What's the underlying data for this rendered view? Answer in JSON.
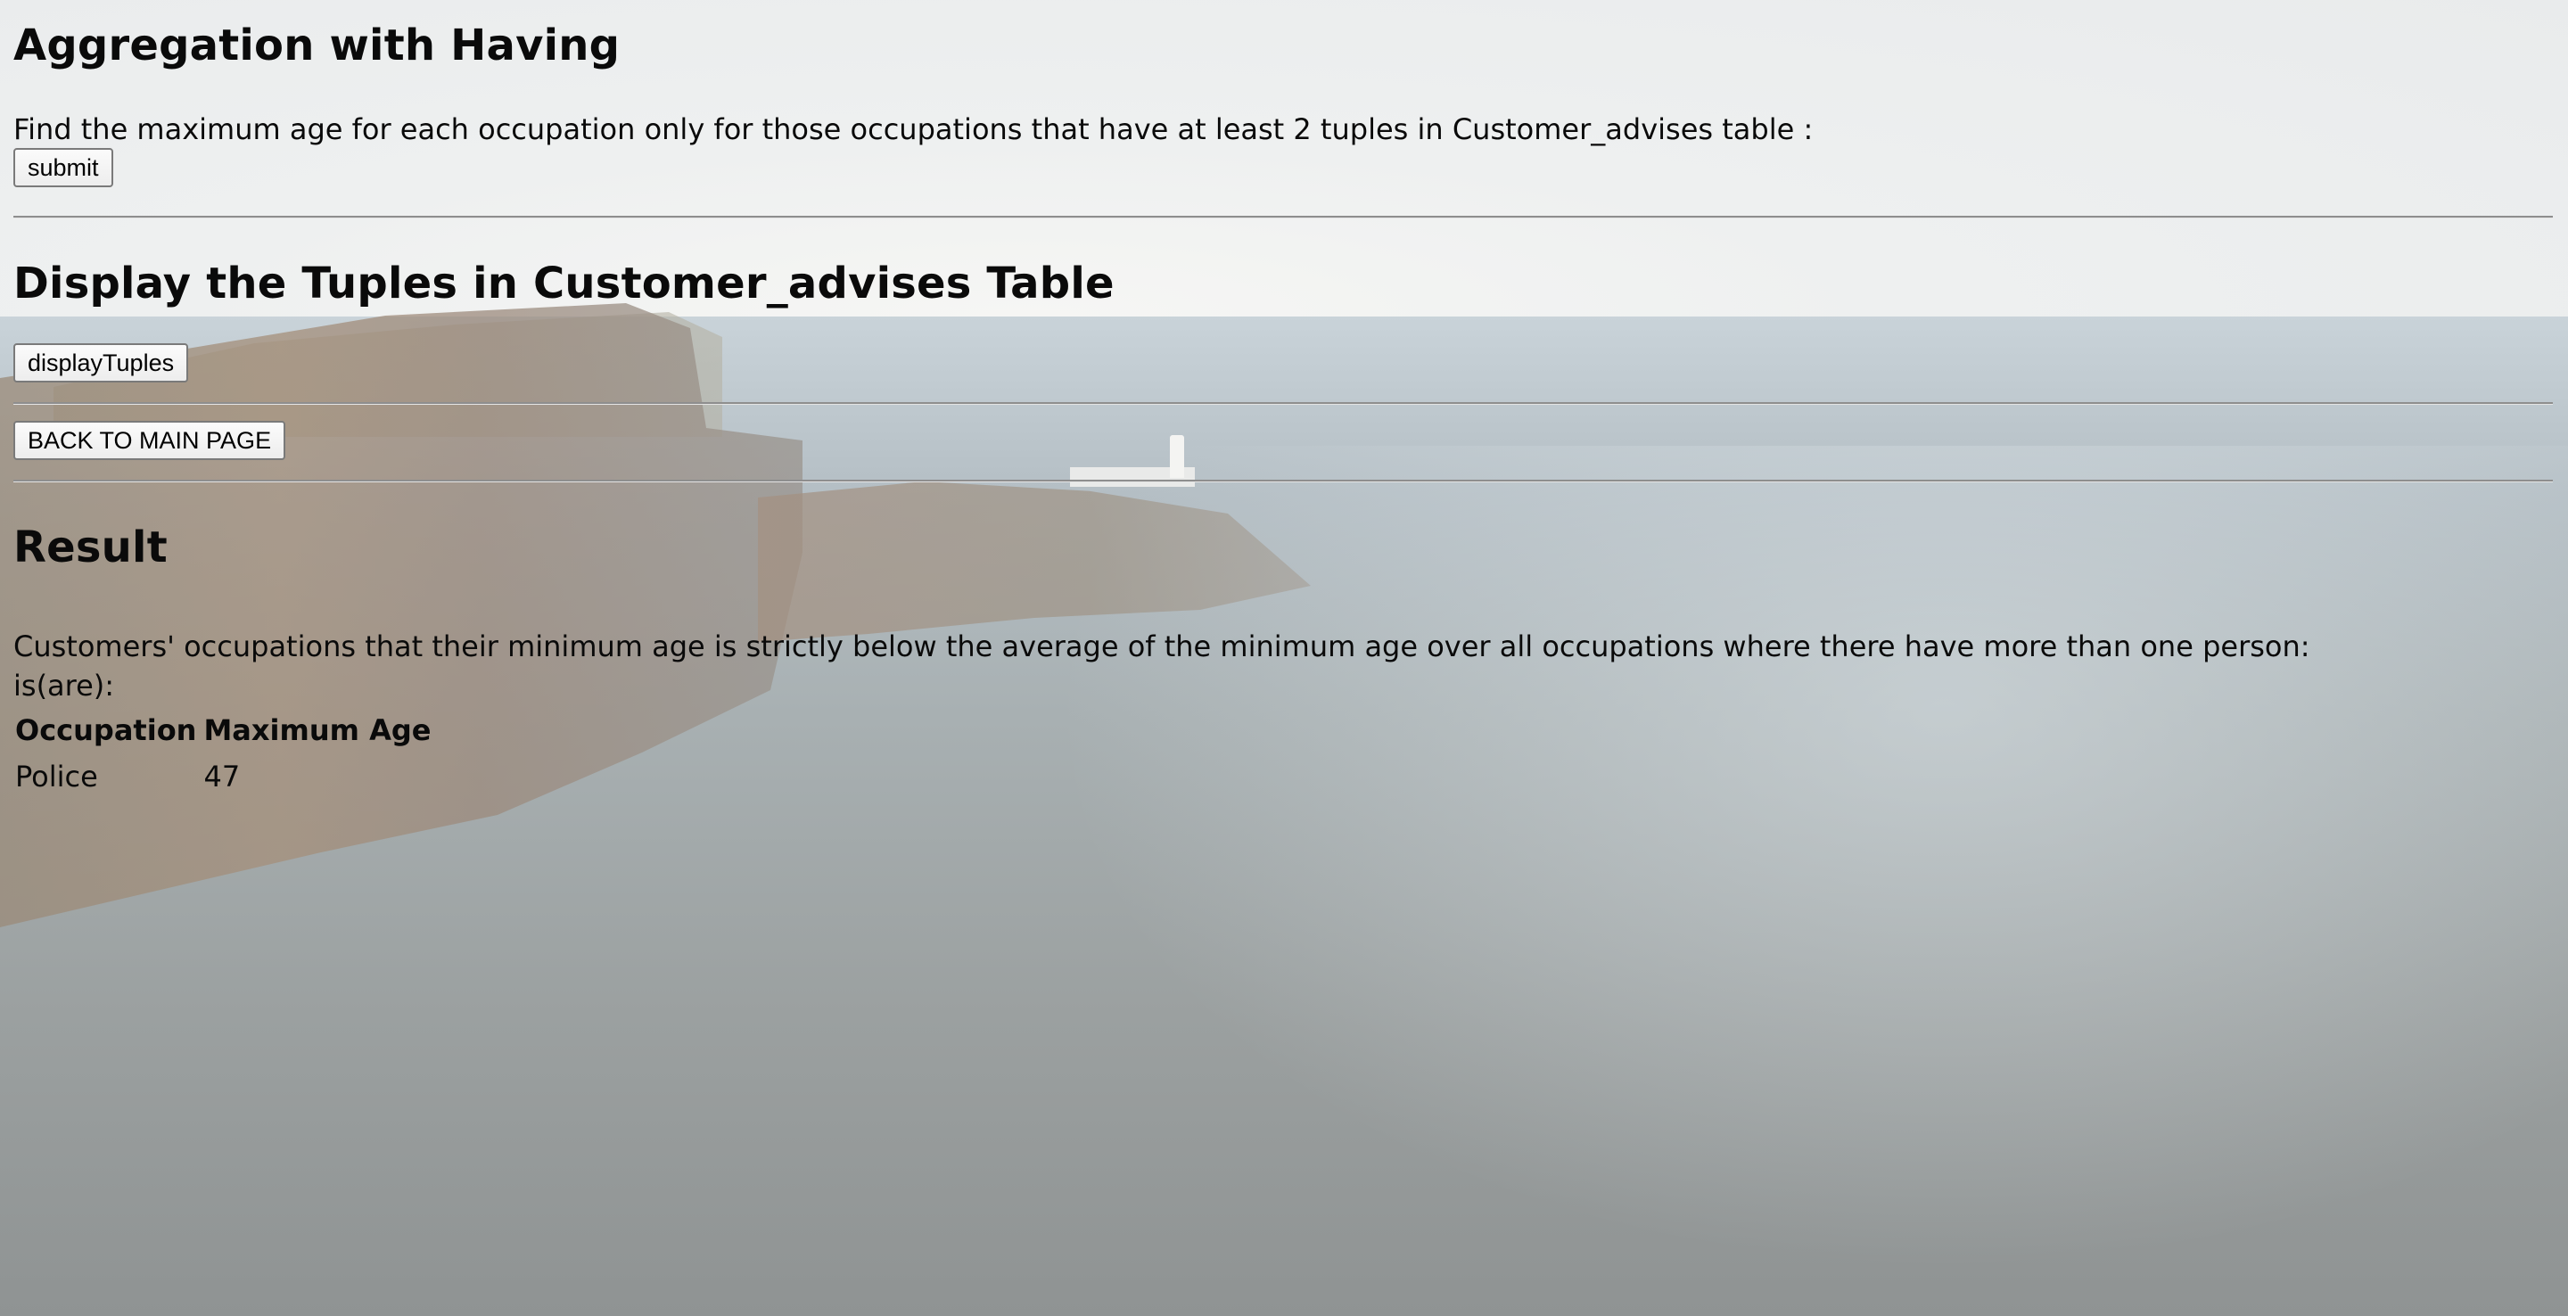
{
  "sections": {
    "aggregation": {
      "title": "Aggregation with Having",
      "description": "Find the maximum age for each occupation only for those occupations that have at least 2 tuples in Customer_advises table :",
      "submit_label": "submit"
    },
    "display": {
      "title": "Display the Tuples in Customer_advises Table",
      "button_label": "displayTuples"
    },
    "navigation": {
      "back_label": "BACK TO MAIN PAGE"
    },
    "result": {
      "title": "Result",
      "description_line1": "Customers' occupations that their minimum age is strictly below the average of the minimum age over all occupations where there have more than one person:",
      "description_line2": "is(are):",
      "table": {
        "headers": [
          "Occupation",
          "Maximum Age"
        ],
        "rows": [
          [
            "Police",
            "47"
          ]
        ]
      }
    }
  }
}
